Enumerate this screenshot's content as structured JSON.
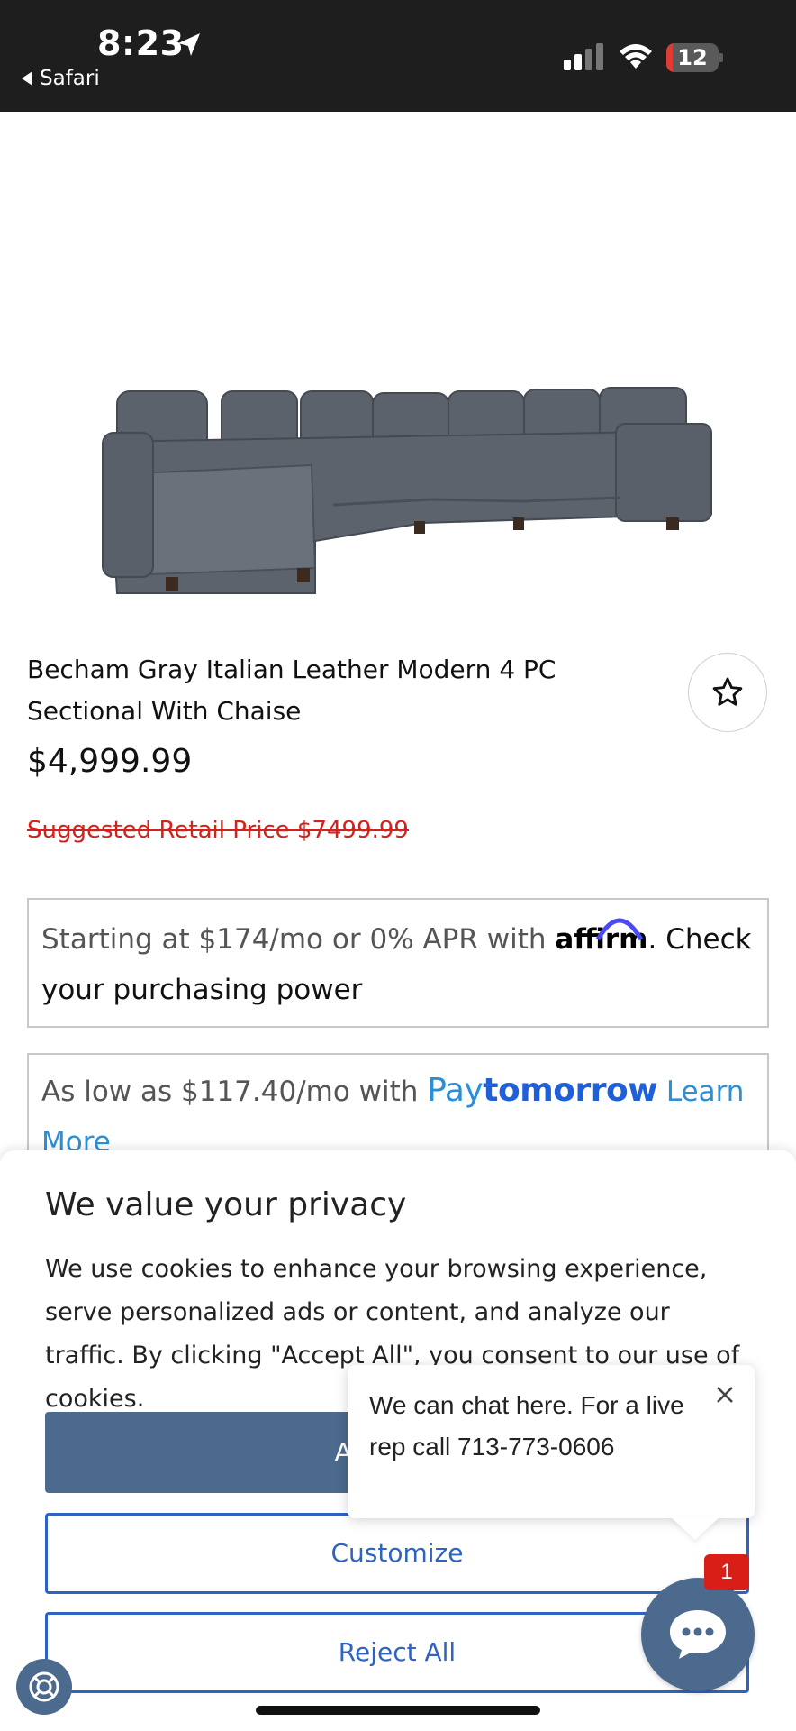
{
  "status_bar": {
    "time": "8:23",
    "back_app": "Safari",
    "battery": "12",
    "battery_level_percent": 12
  },
  "product": {
    "title": "Becham Gray Italian Leather Modern 4 PC Sectional With Chaise",
    "price": "$4,999.99",
    "suggested_retail": "Suggested Retail Price $7499.99",
    "image_alt": "Gray leather sectional sofa with chaise"
  },
  "financing": {
    "affirm_prefix": "Starting at $174/mo or 0% APR with",
    "affirm_brand": "affirm",
    "affirm_suffix": ". Check your purchasing power",
    "paytomorrow_prefix": "As low as $117.40/mo with",
    "paytomorrow_brand_pay": "Pay",
    "paytomorrow_brand_tomorrow": "tomorrow",
    "paytomorrow_link": "Learn More"
  },
  "privacy": {
    "title": "We value your privacy",
    "text": "We use cookies to enhance your browsing experience, serve personalized ads or content, and analyze our traffic. By clicking \"Accept All\", you consent to our use of cookies.",
    "accept_label": "Accept All",
    "customize_label": "Customize",
    "reject_label": "Reject All"
  },
  "chat": {
    "message": "We can chat here. For a live rep call 713-773-0606",
    "badge_count": "1"
  },
  "colors": {
    "primary_button": "#4b6a8e",
    "outline_button": "#2f63c2",
    "strike_red": "#d6201c",
    "badge_red": "#d91e18",
    "affirm_blue": "#4a4af4",
    "paytomorrow_blue": "#1f5fd8"
  },
  "icons": {
    "location": "location-arrow-icon",
    "signal": "cellular-signal-icon",
    "wifi": "wifi-icon",
    "favorite": "star-outline-icon",
    "close": "close-icon",
    "chat": "chat-bubble-icon",
    "consent": "cookie-consent-icon"
  }
}
